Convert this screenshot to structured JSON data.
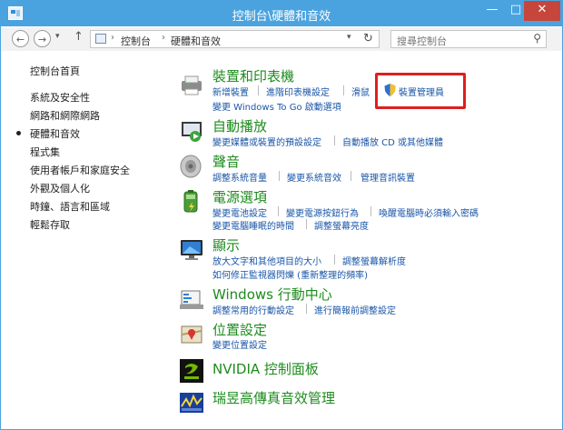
{
  "window": {
    "title": "控制台\\硬體和音效",
    "min": "—",
    "max": "□",
    "close": "✕"
  },
  "nav": {
    "back": "←",
    "forward": "→",
    "recent": "▾",
    "up": "↑"
  },
  "address": {
    "sep": "›",
    "crumbs": [
      "控制台",
      "硬體和音效"
    ],
    "dropdown": "▾",
    "refresh": "↻"
  },
  "search": {
    "placeholder": "搜尋控制台",
    "icon": "⚲"
  },
  "sidebar": {
    "items": [
      "控制台首頁",
      "系統及安全性",
      "網路和網際網路",
      "硬體和音效",
      "程式集",
      "使用者帳戶和家庭安全",
      "外觀及個人化",
      "時鐘、語言和區域",
      "輕鬆存取"
    ],
    "current": "硬體和音效"
  },
  "categories": {
    "devices": {
      "title": "裝置和印表機",
      "links": [
        "新增裝置",
        "進階印表機設定",
        "滑鼠",
        "裝置管理員",
        "變更 Windows To Go 啟動選項"
      ]
    },
    "autoplay": {
      "title": "自動播放",
      "links": [
        "變更媒體或裝置的預設設定",
        "自動播放 CD 或其他媒體"
      ]
    },
    "sound": {
      "title": "聲音",
      "links": [
        "調整系統音量",
        "變更系統音效",
        "管理音訊裝置"
      ]
    },
    "power": {
      "title": "電源選項",
      "links": [
        "變更電池設定",
        "變更電源按鈕行為",
        "喚醒電腦時必須輸入密碼",
        "變更電腦睡眠的時間",
        "調整螢幕亮度"
      ]
    },
    "display": {
      "title": "顯示",
      "links": [
        "放大文字和其他項目的大小",
        "調整螢幕解析度",
        "如何修正監視器閃爍 (重新整理的頻率)"
      ]
    },
    "mobility": {
      "title": "Windows 行動中心",
      "links": [
        "調整常用的行動設定",
        "進行簡報前調整設定"
      ]
    },
    "location": {
      "title": "位置設定",
      "links": [
        "變更位置設定"
      ]
    },
    "nvidia": {
      "title": "NVIDIA 控制面板"
    },
    "realtek": {
      "title": "瑞昱高傳真音效管理"
    }
  }
}
